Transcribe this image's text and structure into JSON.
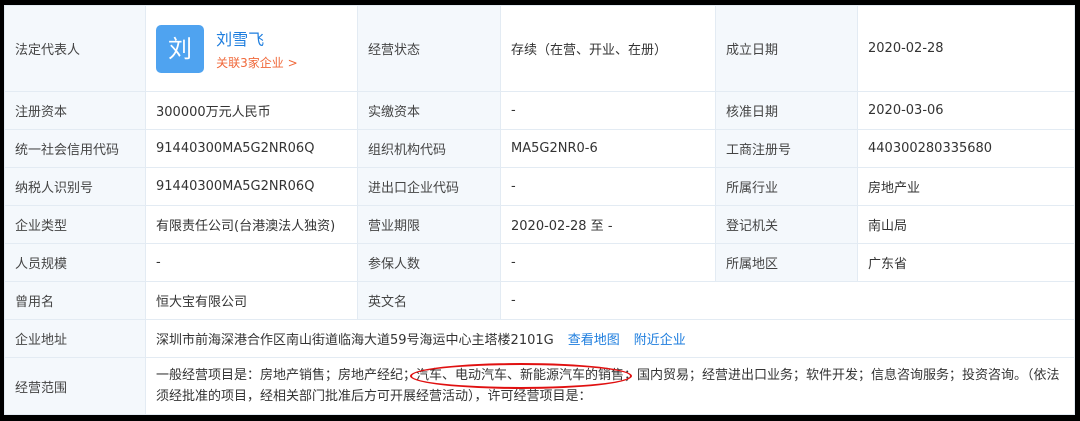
{
  "rows": [
    {
      "l1": "法定代表人",
      "l2": "经营状态",
      "v2": "存续（在营、开业、在册）",
      "l3": "成立日期",
      "v3": "2020-02-28"
    },
    {
      "l1": "注册资本",
      "v1": "300000万元人民币",
      "l2": "实缴资本",
      "v2": "-",
      "l3": "核准日期",
      "v3": "2020-03-06"
    },
    {
      "l1": "统一社会信用代码",
      "v1": "91440300MA5G2NR06Q",
      "l2": "组织机构代码",
      "v2": "MA5G2NR0-6",
      "l3": "工商注册号",
      "v3": "440300280335680"
    },
    {
      "l1": "纳税人识别号",
      "v1": "91440300MA5G2NR06Q",
      "l2": "进出口企业代码",
      "v2": "-",
      "l3": "所属行业",
      "v3": "房地产业"
    },
    {
      "l1": "企业类型",
      "v1": "有限责任公司(台港澳法人独资)",
      "l2": "营业期限",
      "v2": "2020-02-28 至 -",
      "l3": "登记机关",
      "v3": "南山局"
    },
    {
      "l1": "人员规模",
      "v1": "-",
      "l2": "参保人数",
      "v2": "-",
      "l3": "所属地区",
      "v3": "广东省"
    },
    {
      "l1": "曾用名",
      "v1": "恒大宝有限公司",
      "l2": "英文名",
      "v2": "-"
    }
  ],
  "representative": {
    "avatar_char": "刘",
    "name": "刘雪飞",
    "related": "关联3家企业 >",
    "avatar_color": "#4fa3f0"
  },
  "address": {
    "label": "企业地址",
    "value": "深圳市前海深港合作区南山街道临海大道59号海运中心主塔楼2101G",
    "map_link": "查看地图",
    "nearby_link": "附近企业"
  },
  "scope": {
    "label": "经营范围",
    "part1": "一般经营项目是：房地产销售；房地产经纪；",
    "highlight": "汽车、电动汽车、新能源汽车的销售",
    "part2": "；国内贸易；经营进出口业务；软件开发；信息咨询服务；投资咨询。（依法须经批准的项目，经相关部门批准后方可开展经营活动），许可经营项目是："
  }
}
